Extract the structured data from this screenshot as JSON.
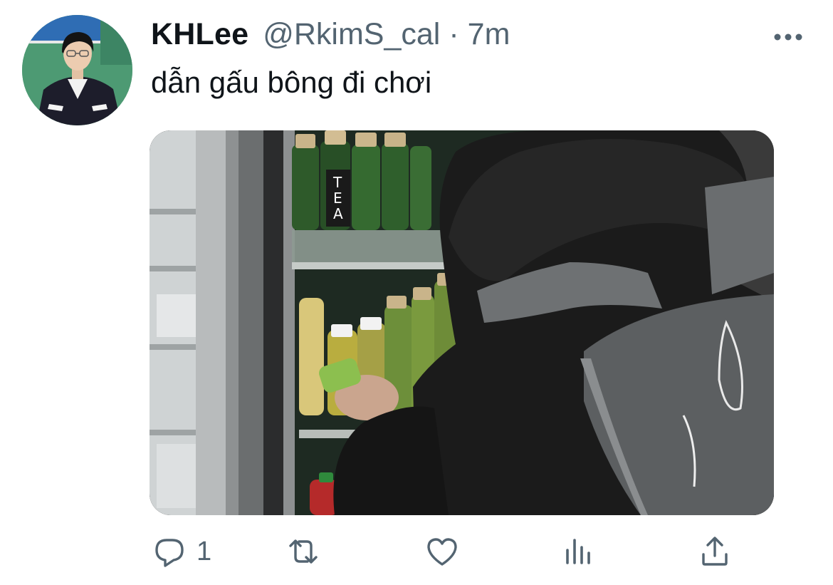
{
  "tweet": {
    "author": {
      "display_name": "KHLee",
      "handle": "@RkimS_cal",
      "avatar_icon": "profile-photo"
    },
    "separator": "·",
    "timestamp": "7m",
    "text": "dẫn gấu bông đi chơi",
    "more_icon": "more-horizontal-icon",
    "media": {
      "type": "photo",
      "bottle_label": "TEA"
    },
    "actions": {
      "reply": {
        "icon": "reply-icon",
        "count": "1"
      },
      "retweet": {
        "icon": "retweet-icon",
        "count": ""
      },
      "like": {
        "icon": "heart-icon",
        "count": ""
      },
      "views": {
        "icon": "analytics-icon",
        "count": ""
      },
      "share": {
        "icon": "share-icon",
        "count": ""
      }
    }
  },
  "colors": {
    "text_primary": "#0f1419",
    "text_secondary": "#536471",
    "background": "#ffffff"
  }
}
